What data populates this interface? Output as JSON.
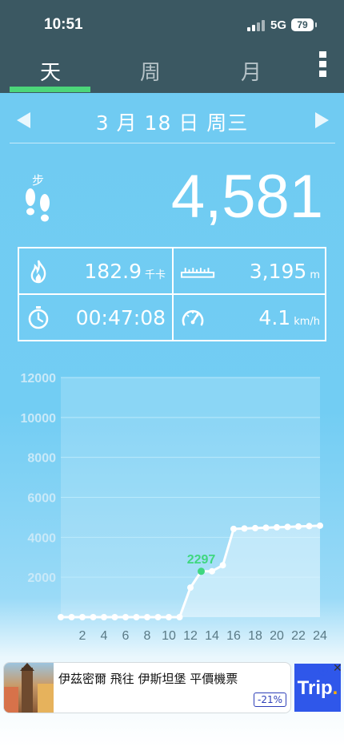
{
  "status_bar": {
    "time": "10:51",
    "network": "5G",
    "battery": "79"
  },
  "tabs": [
    {
      "label": "天",
      "active": true
    },
    {
      "label": "周",
      "active": false
    },
    {
      "label": "月",
      "active": false
    }
  ],
  "date": {
    "label": "3 月 18 日 周三"
  },
  "steps": {
    "label": "步",
    "value": "4,581"
  },
  "stats": {
    "calories": {
      "value": "182.9",
      "unit": "千卡"
    },
    "distance": {
      "value": "3,195",
      "unit": "m"
    },
    "duration": {
      "value": "00:47:08",
      "unit": ""
    },
    "speed": {
      "value": "4.1",
      "unit": "km/h"
    }
  },
  "colors": {
    "header": "#3b5862",
    "tab_indicator": "#4cd67a",
    "highlight_point": "#3fd77f"
  },
  "chart_data": {
    "type": "area",
    "y_ticks": [
      "12000",
      "10000",
      "8000",
      "6000",
      "4000",
      "2000"
    ],
    "x_ticks": [
      "2",
      "4",
      "6",
      "8",
      "10",
      "12",
      "14",
      "16",
      "18",
      "20",
      "22",
      "24"
    ],
    "ylim": [
      0,
      12000
    ],
    "xlim": [
      0,
      24
    ],
    "x": [
      0,
      1,
      2,
      3,
      4,
      5,
      6,
      7,
      8,
      9,
      10,
      11,
      12,
      13,
      14,
      15,
      16,
      17,
      18,
      19,
      20,
      21,
      22,
      23,
      24
    ],
    "values": [
      0,
      0,
      0,
      0,
      0,
      0,
      0,
      0,
      0,
      0,
      0,
      0,
      1480,
      2297,
      2300,
      2600,
      4420,
      4440,
      4460,
      4480,
      4500,
      4520,
      4540,
      4560,
      4581
    ],
    "highlight": {
      "x": 13,
      "value": 2297,
      "label": "2297"
    }
  },
  "ad": {
    "title": "伊茲密爾 飛往 伊斯坦堡 平價機票",
    "discount": "-21%",
    "brand": "Trip",
    "brand_dot": ".",
    "info": "ⓘ",
    "close": "✕"
  }
}
